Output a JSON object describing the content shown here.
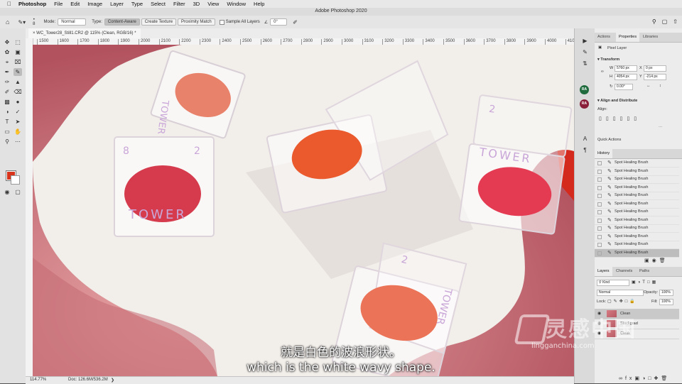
{
  "menubar": {
    "apple": "",
    "app": "Photoshop",
    "items": [
      "File",
      "Edit",
      "Image",
      "Layer",
      "Type",
      "Select",
      "Filter",
      "3D",
      "View",
      "Window",
      "Help"
    ]
  },
  "window": {
    "title": "Adobe Photoshop 2020"
  },
  "options": {
    "brush_size": "8",
    "mode_label": "Mode:",
    "mode_value": "Normal",
    "type_label": "Type:",
    "type_buttons": [
      "Content-Aware",
      "Create Texture",
      "Proximity Match"
    ],
    "sample_all": "Sample All Layers",
    "angle_value": "0°"
  },
  "document": {
    "tab_title": "WC_Tower28_Still1.CR2 @ 115% (Clean, RGB/16) *",
    "ruler_ticks": [
      "1500",
      "1600",
      "1700",
      "1800",
      "1900",
      "2000",
      "2100",
      "2200",
      "2300",
      "2400",
      "2500",
      "2600",
      "2700",
      "2800",
      "2900",
      "3000",
      "3100",
      "3200",
      "3300",
      "3400",
      "3500",
      "3600",
      "3700",
      "3800",
      "3900",
      "4000",
      "410"
    ],
    "zoom": "114.77%",
    "doc_size": "Doc: 126.6M/536.2M"
  },
  "compacts": [
    {
      "numbers": [
        "TOWER"
      ]
    },
    {
      "numbers": [
        "8",
        "2",
        "TOWER"
      ]
    },
    {
      "numbers": [
        "2",
        "TOWER"
      ]
    },
    {
      "numbers": [
        "2",
        "TOWER"
      ]
    }
  ],
  "subtitles": {
    "cn": "就是白色的波浪形状。",
    "en": "which is the white wavy shape."
  },
  "iconstrip": {
    "avatars": [
      "RA",
      "RA"
    ]
  },
  "properties": {
    "tabs": [
      "Actions",
      "Properties",
      "Libraries"
    ],
    "layer_kind": "Pixel Layer",
    "transform_title": "Transform",
    "w_label": "W",
    "w_value": "5760 px",
    "x_label": "X",
    "x_value": "0 px",
    "h_label": "H",
    "h_value": "4054 px",
    "y_label": "Y",
    "y_value": "-214 px",
    "angle": "0.00°",
    "align_title": "Align and Distribute",
    "align_label": "Align:",
    "quick_actions": "Quick Actions"
  },
  "history": {
    "title": "History",
    "items": [
      "Spot Healing Brush",
      "Spot Healing Brush",
      "Spot Healing Brush",
      "Spot Healing Brush",
      "Spot Healing Brush",
      "Spot Healing Brush",
      "Spot Healing Brush",
      "Spot Healing Brush",
      "Spot Healing Brush",
      "Spot Healing Brush",
      "Spot Healing Brush",
      "Spot Healing Brush"
    ]
  },
  "layers": {
    "tabs": [
      "Layers",
      "Channels",
      "Paths"
    ],
    "filter_kind": "Kind",
    "blend_mode": "Normal",
    "opacity_label": "Opacity:",
    "opacity_value": "100%",
    "lock_label": "Lock:",
    "fill_label": "Fill:",
    "fill_value": "100%",
    "rows": [
      "Clean",
      "Stockgrad",
      "Cleak"
    ]
  },
  "watermark": {
    "logo": "灵感中国",
    "url": "lingganchina.com"
  }
}
